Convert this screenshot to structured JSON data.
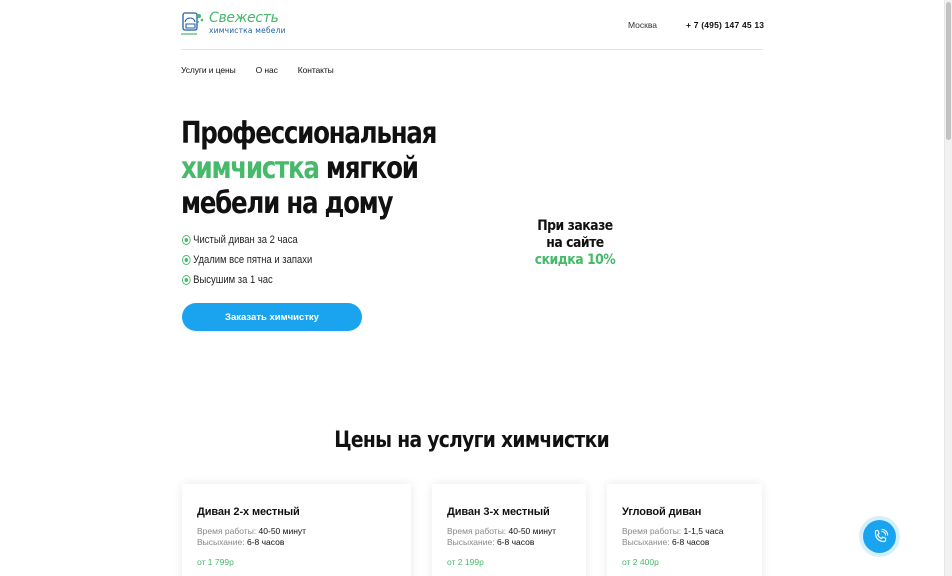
{
  "header": {
    "logo": {
      "title": "Свежесть",
      "subtitle": "химчистка мебели"
    },
    "city": "Москва",
    "phone": "+ 7 (495) 147 45 13"
  },
  "nav": {
    "items": [
      {
        "label": "Услуги и цены"
      },
      {
        "label": "О нас"
      },
      {
        "label": "Контакты"
      }
    ]
  },
  "hero": {
    "title_line1": "Профессиональная",
    "title_green": "химчистка",
    "title_line2_rest": "мягкой",
    "title_line3": "мебели на дому",
    "features": [
      {
        "text": "Чистый диван за 2 часа"
      },
      {
        "text": "Удалим все пятна и запахи"
      },
      {
        "text": "Высушим за 1 час"
      }
    ],
    "order_button": "Заказать химчистку",
    "promo_line1": "При заказе",
    "promo_line2": "на сайте",
    "promo_line3": "скидка 10%"
  },
  "prices": {
    "title": "Цены на услуги химчистки",
    "cards": [
      {
        "title": "Диван 2-х местный",
        "work_label": "Время работы:",
        "work_value": "40-50 минут",
        "dry_label": "Высыхание:",
        "dry_value": "6-8 часов",
        "price": "от 1 799р"
      },
      {
        "title": "Диван 3-х местный",
        "work_label": "Время работы:",
        "work_value": "40-50 минут",
        "dry_label": "Высыхание:",
        "dry_value": "6-8 часов",
        "price": "от 2 199р"
      },
      {
        "title": "Угловой диван",
        "work_label": "Время работы:",
        "work_value": "1-1,5 часа",
        "dry_label": "Высыхание:",
        "dry_value": "6-8 часов",
        "price": "от 2 400р"
      }
    ]
  },
  "colors": {
    "accent_green": "#46b96a",
    "accent_blue": "#1aa4ef"
  },
  "icons": {
    "call": "phone-icon",
    "feature": "check-circle-icon",
    "logo": "logo-sofa-icon"
  }
}
